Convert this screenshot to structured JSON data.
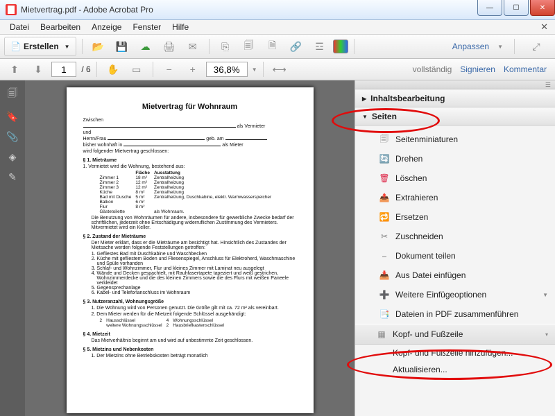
{
  "window": {
    "title": "Mietvertrag.pdf - Adobe Acrobat Pro"
  },
  "menubar": {
    "items": [
      "Datei",
      "Bearbeiten",
      "Anzeige",
      "Fenster",
      "Hilfe"
    ]
  },
  "toolbar1": {
    "create_label": "Erstellen",
    "customize_label": "Anpassen"
  },
  "toolbar2": {
    "page_current": "1",
    "page_total": "6",
    "zoom": "36,8%",
    "links": {
      "full": "vollständig",
      "sign": "Signieren",
      "comment": "Kommentar"
    }
  },
  "document": {
    "title": "Mietvertrag für Wohnraum",
    "zwischen": "Zwischen",
    "vermieter_lbl": "als Vermieter",
    "und": "und",
    "herrn_frau": "Herrn/Frau",
    "geb_am": "geb. am",
    "bisher_wohnhaft": "bisher wohnhaft in",
    "mieter_lbl": "als Mieter",
    "intro": "wird folgender Mietvertrag geschlossen:",
    "sec1_hdr": "§ 1.  Mieträume",
    "sec1_1": "1. Vermietet wird die Wohnung, bestehend aus:",
    "tbl_head": [
      "",
      "Fläche",
      "Ausstattung"
    ],
    "tbl_rows": [
      [
        "Zimmer 1",
        "18 m²",
        "Zentralheizung"
      ],
      [
        "Zimmer 2",
        "12 m²",
        "Zentralheizung"
      ],
      [
        "Zimmer 3",
        "12 m²",
        "Zentralheizung"
      ],
      [
        "Küche",
        "8 m²",
        "Zentralheizung"
      ],
      [
        "Bad mit Dusche",
        "5 m²",
        "Zentralheizung, Duschkabine, elektr. Warmwasserspeicher"
      ],
      [
        "Balkon",
        "6 m²",
        ""
      ],
      [
        "Flur",
        "8 m²",
        ""
      ],
      [
        "Gästetoilette",
        "",
        "als Wohnraum."
      ]
    ],
    "sec1_2": "Die Benutzung von Wohnräumen für andere, insbesondere für gewerbliche Zwecke bedarf der schriftlichen, jederzeit ohne Entschädigung widerruflichen Zustimmung des Vermieters. Mitvermietet wird ein Keller.",
    "sec2_hdr": "§ 2.  Zustand der Mieträume",
    "sec2_intro": "Der Mieter erklärt, dass er die Mieträume am             besichtigt hat. Hinsichtlich des Zustandes der Mietsache werden folgende Feststellungen getroffen:",
    "sec2_items": [
      "Gefliestes Bad mit Duschkabine und Waschbecken",
      "Küche mit gefliestem Boden und Fliesenspiegel, Anschluss für Elektroherd, Waschmaschine und Spüle vorhanden",
      "Schlaf- und Wohnzimmer, Flur und kleines Zimmer mit Laminat neu ausgelegt",
      "Wände und Decken gespachtelt, mit Rauhfasertapete tapeziert und weiß gestrichen, Wohnzimmerdecke und die des kleinen Zimmers sowie die des Flurs mit weißen Paneele verkleidet",
      "Gegensprechanlage",
      "Kabel- und Telefonanschluss im Wohnraum"
    ],
    "sec3_hdr": "§ 3.  Nutzeranzahl, Wohnungsgröße",
    "sec3_1": "1. Die Wohnung wird von        Personen genutzt. Die Größe gilt mit ca. 72 m² als vereinbart.",
    "sec3_2": "2. Dem Mieter werden für die Mietzeit folgende Schlüssel ausgehändigt:",
    "keys": [
      [
        "2",
        "Hausschlüssel",
        "4",
        "Wohnungsschlüssel"
      ],
      [
        "",
        "weitere Wohnungsschlüssel",
        "2",
        "Hausbriefkastenschlüssel"
      ]
    ],
    "sec4_hdr": "§ 4.  Mietzeit",
    "sec4_txt": "Das Mietverhältnis beginnt am            und wird auf unbestimmte Zeit geschlossen.",
    "sec5_hdr": "§ 5.  Mietzins und Nebenkosten",
    "sec5_txt": "1. Der Mietzins ohne Betriebskosten beträgt monatlich"
  },
  "right_panel": {
    "section_content_edit": "Inhaltsbearbeitung",
    "section_pages": "Seiten",
    "tools": {
      "thumbnails": "Seitenminiaturen",
      "rotate": "Drehen",
      "delete": "Löschen",
      "extract": "Extrahieren",
      "replace": "Ersetzen",
      "crop": "Zuschneiden",
      "split": "Dokument teilen",
      "insert_file": "Aus Datei einfügen",
      "more_insert": "Weitere Einfügeoptionen",
      "combine": "Dateien in PDF zusammenführen",
      "header_footer": "Kopf- und Fußzeile",
      "hf_add": "Kopf- und Fußzeile hinzufügen...",
      "hf_update": "Aktualisieren..."
    }
  }
}
